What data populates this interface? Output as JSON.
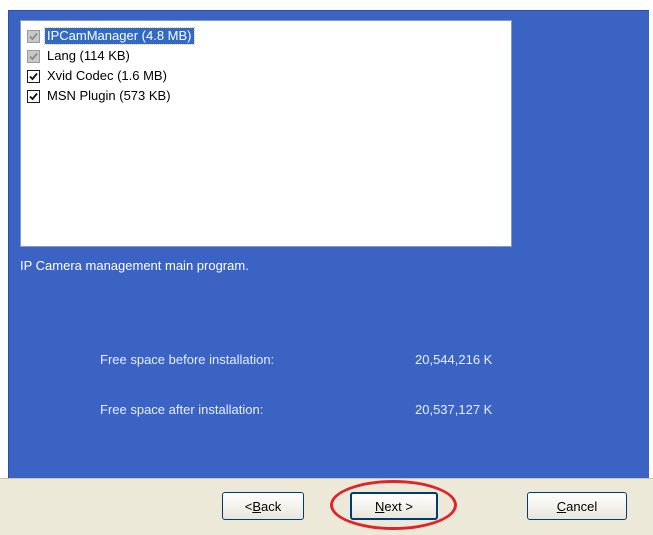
{
  "components": {
    "items": [
      {
        "label": "IPCamManager (4.8 MB)",
        "checked": true,
        "disabled": true,
        "selected": true
      },
      {
        "label": "Lang (114 KB)",
        "checked": true,
        "disabled": true,
        "selected": false
      },
      {
        "label": "Xvid Codec (1.6 MB)",
        "checked": true,
        "disabled": false,
        "selected": false
      },
      {
        "label": "MSN Plugin (573 KB)",
        "checked": true,
        "disabled": false,
        "selected": false
      }
    ]
  },
  "description": "IP Camera management main program.",
  "space": {
    "before_label": "Free space before installation:",
    "before_value": "20,544,216 K",
    "after_label": "Free space after installation:",
    "after_value": "20,537,127 K"
  },
  "buttons": {
    "back": {
      "prefix": "< ",
      "mnemonic": "B",
      "rest": "ack"
    },
    "next": {
      "mnemonic": "N",
      "rest": "ext >"
    },
    "cancel": {
      "mnemonic": "C",
      "rest": "ancel"
    }
  },
  "colors": {
    "panel": "#3a63c3",
    "highlight_ellipse": "#e0242a",
    "selection": "#316ac5"
  }
}
